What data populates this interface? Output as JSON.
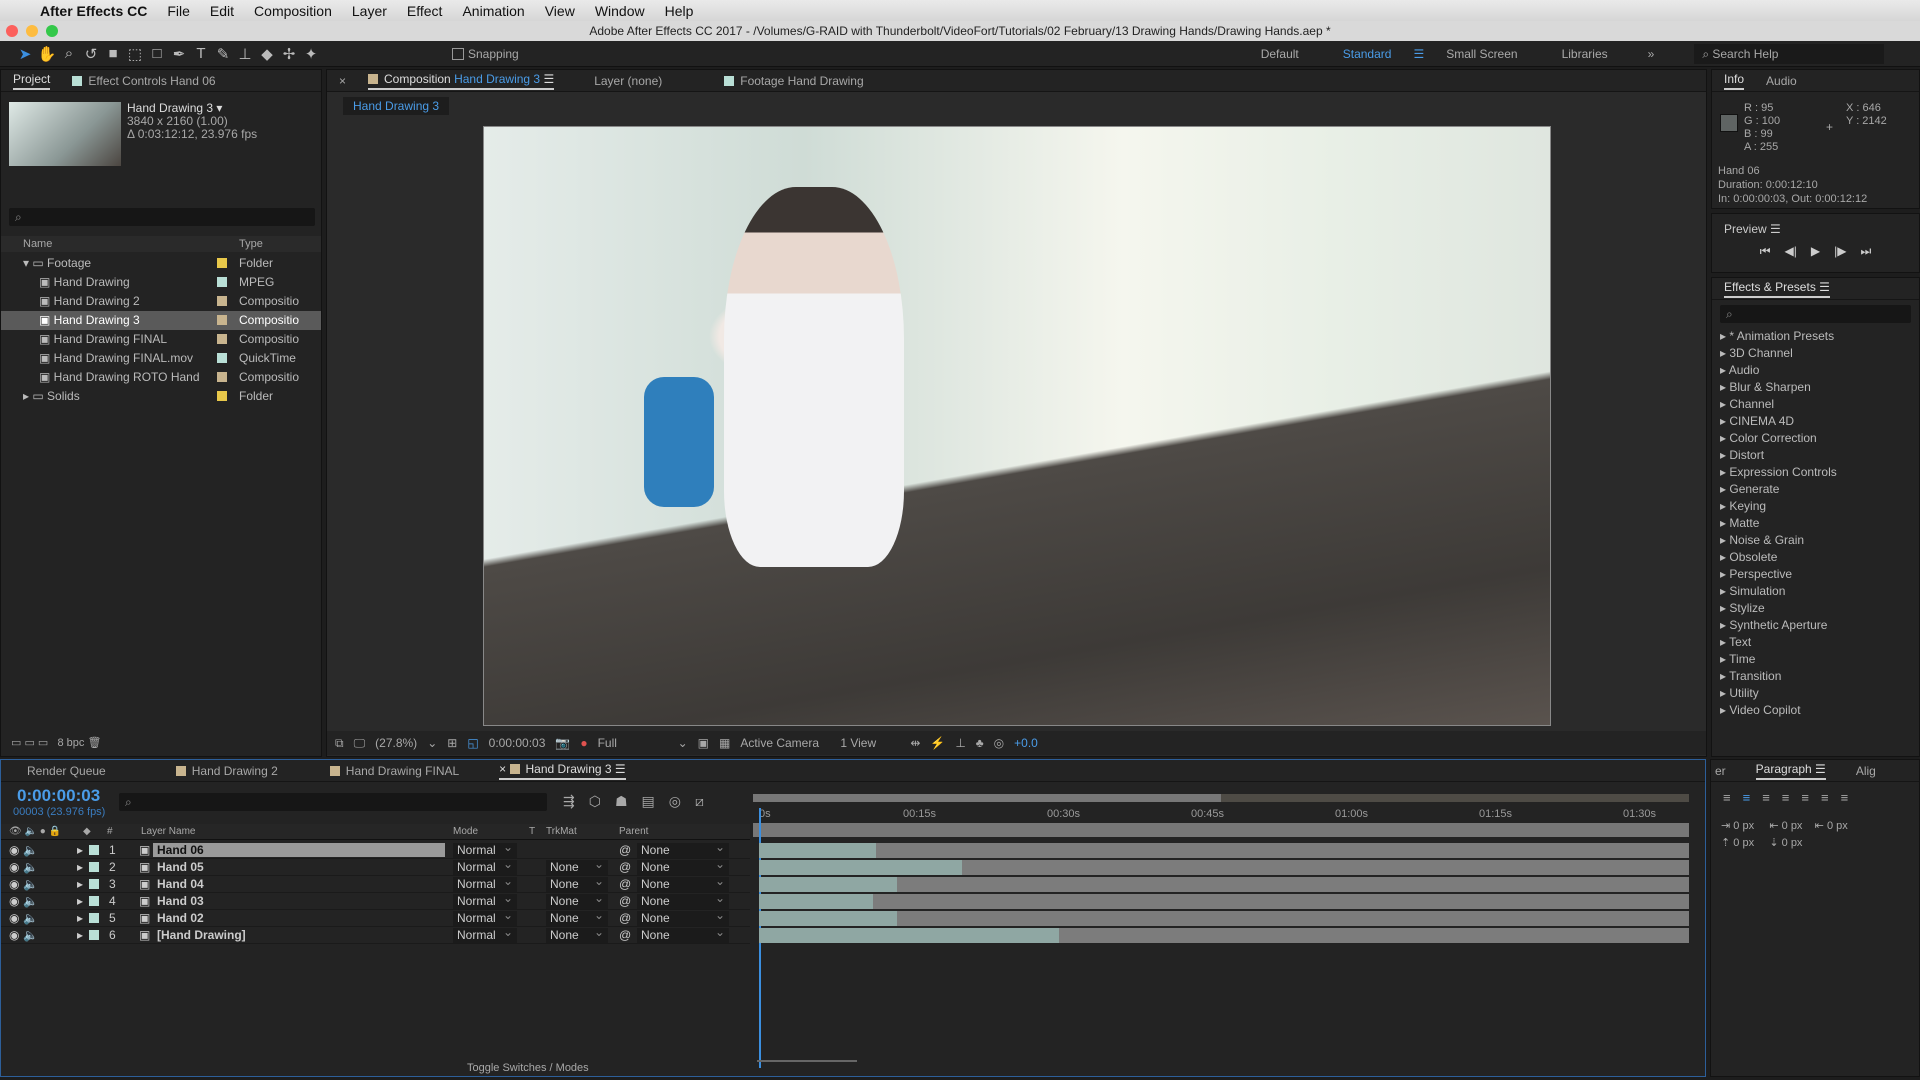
{
  "menu": {
    "app": "After Effects CC",
    "items": [
      "File",
      "Edit",
      "Composition",
      "Layer",
      "Effect",
      "Animation",
      "View",
      "Window",
      "Help"
    ]
  },
  "window_title": "Adobe After Effects CC 2017 - /Volumes/G-RAID with Thunderbolt/VideoFort/Tutorials/02 February/13 Drawing Hands/Drawing Hands.aep *",
  "toolbar": {
    "snapping": "Snapping",
    "workspaces": [
      "Default",
      "Standard",
      "Small Screen",
      "Libraries"
    ],
    "active_workspace": "Standard",
    "search_placeholder": "Search Help"
  },
  "project": {
    "tab": "Project",
    "effect_controls_tab": "Effect Controls Hand 06",
    "selected_name": "Hand Drawing 3 ▾",
    "selected_res": "3840 x 2160 (1.00)",
    "selected_dur": "Δ 0:03:12:12, 23.976 fps",
    "col_name": "Name",
    "col_type": "Type",
    "items": [
      {
        "name": "Footage",
        "type": "Folder",
        "color": "#e8c84a",
        "indent": 0,
        "folder": true,
        "open": true
      },
      {
        "name": "Hand Drawing",
        "type": "MPEG",
        "color": "#b9dfd6",
        "indent": 1
      },
      {
        "name": "Hand Drawing 2",
        "type": "Compositio",
        "color": "#c8b48e",
        "indent": 1
      },
      {
        "name": "Hand Drawing 3",
        "type": "Compositio",
        "color": "#c8b48e",
        "indent": 1,
        "selected": true
      },
      {
        "name": "Hand Drawing FINAL",
        "type": "Compositio",
        "color": "#c8b48e",
        "indent": 1
      },
      {
        "name": "Hand Drawing FINAL.mov",
        "type": "QuickTime",
        "color": "#b9dfd6",
        "indent": 1
      },
      {
        "name": "Hand Drawing ROTO Hand",
        "type": "Compositio",
        "color": "#c8b48e",
        "indent": 1
      },
      {
        "name": "Solids",
        "type": "Folder",
        "color": "#e8c84a",
        "indent": 0,
        "folder": true
      }
    ],
    "bpc": "8 bpc"
  },
  "comp": {
    "tab_prefix": "Composition",
    "tab_name": "Hand Drawing 3",
    "layer_tab": "Layer (none)",
    "footage_tab": "Footage Hand Drawing",
    "breadcrumb": "Hand Drawing 3",
    "footer": {
      "zoom": "(27.8%)",
      "time": "0:00:00:03",
      "resolution": "Full",
      "camera": "Active Camera",
      "views": "1 View",
      "exposure": "+0.0"
    }
  },
  "info": {
    "tab": "Info",
    "audio_tab": "Audio",
    "r": "R : 95",
    "g": "G : 100",
    "b": "B : 99",
    "a": "A : 255",
    "x": "X : 646",
    "y": "Y : 2142",
    "sample_color": "#5f6463",
    "layer": "Hand 06",
    "duration": "Duration: 0:00:12:10",
    "inout": "In: 0:00:00:03, Out: 0:00:12:12"
  },
  "preview": {
    "title": "Preview"
  },
  "effects": {
    "title": "Effects & Presets",
    "items": [
      "* Animation Presets",
      "3D Channel",
      "Audio",
      "Blur & Sharpen",
      "Channel",
      "CINEMA 4D",
      "Color Correction",
      "Distort",
      "Expression Controls",
      "Generate",
      "Keying",
      "Matte",
      "Noise & Grain",
      "Obsolete",
      "Perspective",
      "Simulation",
      "Stylize",
      "Synthetic Aperture",
      "Text",
      "Time",
      "Transition",
      "Utility",
      "Video Copilot"
    ]
  },
  "timeline": {
    "tabs": [
      "Render Queue",
      "Hand Drawing 2",
      "Hand Drawing FINAL",
      "Hand Drawing 3"
    ],
    "timecode": "0:00:00:03",
    "frames": "00003 (23.976 fps)",
    "cols": {
      "num": "#",
      "name": "Layer Name",
      "mode": "Mode",
      "t": "T",
      "trkmat": "TrkMat",
      "parent": "Parent"
    },
    "ruler": [
      "0s",
      "00:15s",
      "00:30s",
      "00:45s",
      "01:00s",
      "01:15s",
      "01:30s"
    ],
    "layers": [
      {
        "num": "1",
        "name": "Hand 06",
        "mode": "Normal",
        "trkmat": "",
        "parent": "None"
      },
      {
        "num": "2",
        "name": "Hand 05",
        "mode": "Normal",
        "trkmat": "None",
        "parent": "None"
      },
      {
        "num": "3",
        "name": "Hand 04",
        "mode": "Normal",
        "trkmat": "None",
        "parent": "None"
      },
      {
        "num": "4",
        "name": "Hand 03",
        "mode": "Normal",
        "trkmat": "None",
        "parent": "None"
      },
      {
        "num": "5",
        "name": "Hand 02",
        "mode": "Normal",
        "trkmat": "None",
        "parent": "None"
      },
      {
        "num": "6",
        "name": "[Hand Drawing]",
        "mode": "Normal",
        "trkmat": "None",
        "parent": "None"
      }
    ],
    "toggle": "Toggle Switches / Modes"
  },
  "paragraph": {
    "tab_prev": "er",
    "tab": "Paragraph",
    "tab_next": "Alig",
    "px": [
      "0 px",
      "0 px",
      "0 px",
      "0 px",
      "0 px"
    ]
  }
}
